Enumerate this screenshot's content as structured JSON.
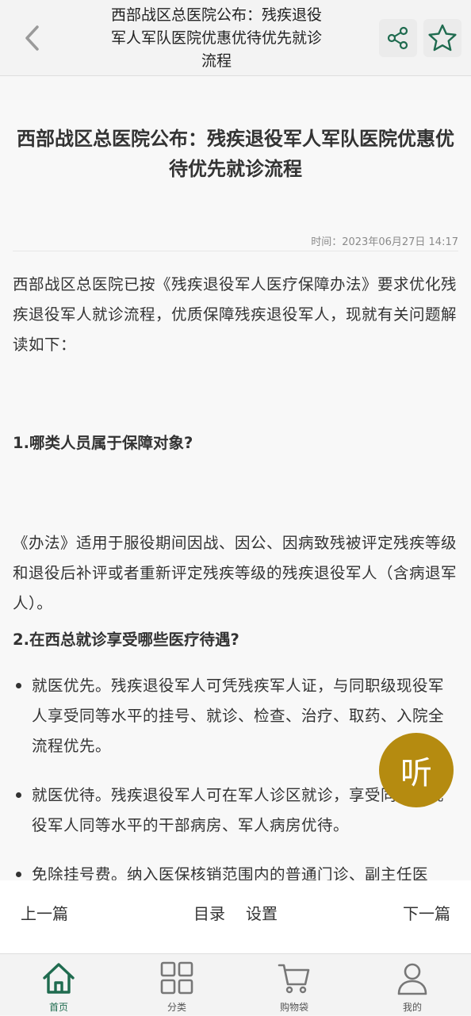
{
  "header": {
    "title": "西部战区总医院公布：残疾退役军人军队医院优惠优待优先就诊流程",
    "back_icon": "chevron-left-icon",
    "share_icon": "share-icon",
    "favorite_icon": "star-icon"
  },
  "article": {
    "title": "西部战区总医院公布：残疾退役军人军队医院优惠优待优先就诊流程",
    "time": "时间：2023年06月27日 14:17",
    "intro": "西部战区总医院已按《残疾退役军人医疗保障办法》要求优化残疾退役军人就诊流程，优质保障残疾退役军人，现就有关问题解读如下：",
    "q1": "1.哪类人员属于保障对象?",
    "a1": "《办法》适用于服役期间因战、因公、因病致残被评定残疾等级和退役后补评或者重新评定残疾等级的残疾退役军人（含病退军人）。",
    "q2": "2.在西总就诊享受哪些医疗待遇?",
    "bullets": [
      "就医优先。残疾退役军人可凭残疾军人证，与同职级现役军人享受同等水平的挂号、就诊、检查、治疗、取药、入院全流程优先。",
      "就医优待。残疾退役军人可在军人诊区就诊，享受同职级现役军人同等水平的干部病房、军人病房优待。",
      "免除挂号费。纳入医保核销范围内的普通门诊、副主任医"
    ]
  },
  "listen_button": {
    "label": "听"
  },
  "reader_bar": {
    "prev": "上一篇",
    "toc": "目录",
    "settings": "设置",
    "next": "下一篇"
  },
  "tabbar": {
    "items": [
      {
        "label": "首页",
        "icon": "home-icon",
        "active": true
      },
      {
        "label": "分类",
        "icon": "grid-icon",
        "active": false
      },
      {
        "label": "购物袋",
        "icon": "cart-icon",
        "active": false
      },
      {
        "label": "我的",
        "icon": "user-icon",
        "active": false
      }
    ]
  },
  "colors": {
    "accent_green": "#1f6b4f",
    "listen_gold": "#b58b10",
    "text": "#333333"
  }
}
